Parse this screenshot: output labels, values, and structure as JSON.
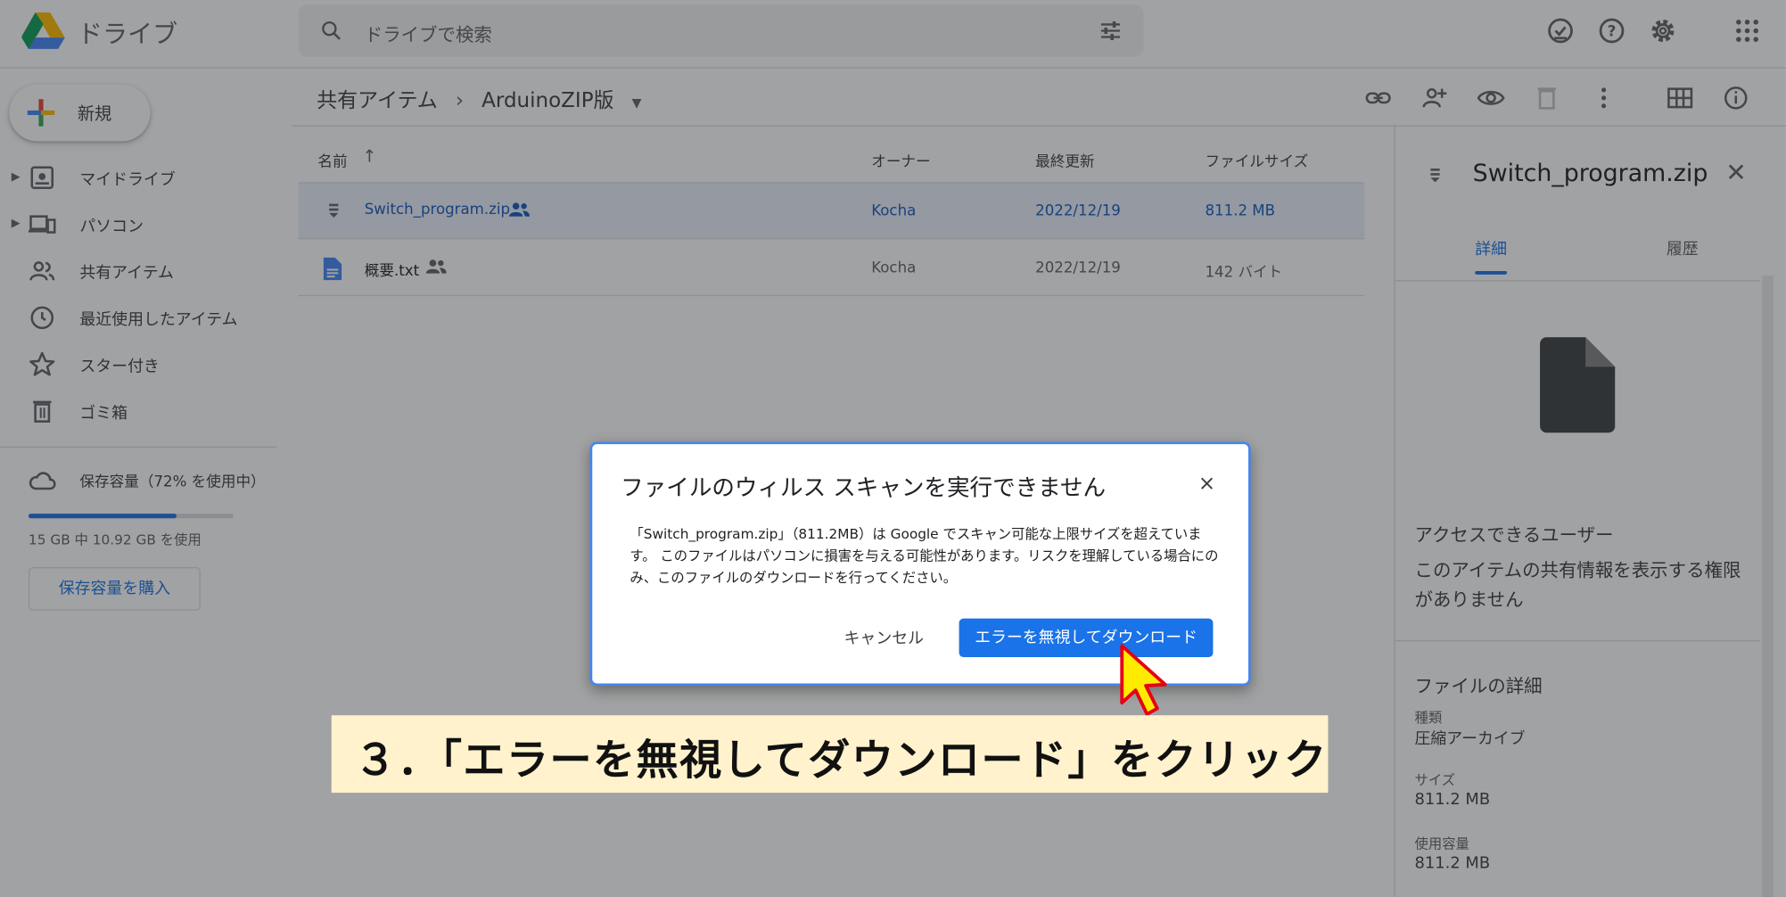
{
  "app": {
    "title": "ドライブ"
  },
  "search": {
    "placeholder": "ドライブで検索"
  },
  "sidebar": {
    "new_label": "新規",
    "items": [
      {
        "label": "マイドライブ",
        "icon": "my-drive-icon"
      },
      {
        "label": "パソコン",
        "icon": "computers-icon"
      },
      {
        "label": "共有アイテム",
        "icon": "shared-icon"
      },
      {
        "label": "最近使用したアイテム",
        "icon": "clock-icon"
      },
      {
        "label": "スター付き",
        "icon": "star-icon"
      },
      {
        "label": "ゴミ箱",
        "icon": "trash-icon"
      }
    ],
    "storage_title": "保存容量（72% を使用中）",
    "storage_usage": "15 GB 中 10.92 GB を使用",
    "storage_fraction": 0.72,
    "buy_label": "保存容量を購入"
  },
  "breadcrumb": {
    "root": "共有アイテム",
    "sep": "›",
    "folder": "ArduinoZIP版"
  },
  "table": {
    "headers": {
      "name": "名前",
      "owner": "オーナー",
      "modified": "最終更新",
      "size": "ファイルサイズ"
    },
    "rows": [
      {
        "name": "Switch_program.zip",
        "owner": "Kocha",
        "modified": "2022/12/19",
        "size": "811.2 MB",
        "selected": true
      },
      {
        "name": "概要.txt",
        "owner": "Kocha",
        "modified": "2022/12/19",
        "size": "142 バイト",
        "selected": false
      }
    ]
  },
  "panel": {
    "title": "Switch_program.zip",
    "tab_details": "詳細",
    "tab_activity": "履歴",
    "access_heading": "アクセスできるユーザー",
    "access_text": "このアイテムの共有情報を表示する権限がありません",
    "details_heading": "ファイルの詳細",
    "type_label": "種類",
    "type_value": "圧縮アーカイブ",
    "size_label": "サイズ",
    "size_value": "811.2 MB",
    "used_label": "使用容量",
    "used_value": "811.2 MB"
  },
  "dialog": {
    "title": "ファイルのウィルス スキャンを実行できません",
    "close": "×",
    "body": "「Switch_program.zip」（811.2MB）は Google でスキャン可能な上限サイズを超えています。 このファイルはパソコンに損害を与える可能性があります。リスクを理解している場合にのみ、このファイルのダウンロードを行ってください。",
    "cancel_label": "キャンセル",
    "confirm_label": "エラーを無視してダウンロード"
  },
  "annotation": {
    "text": "３．「エラーを無視してダウンロード」をクリック"
  },
  "colors": {
    "accent": "#1a73e8",
    "selected_row": "#e8f0fe",
    "callout_bg": "#fff2cc",
    "cursor": "#ffeb00"
  }
}
